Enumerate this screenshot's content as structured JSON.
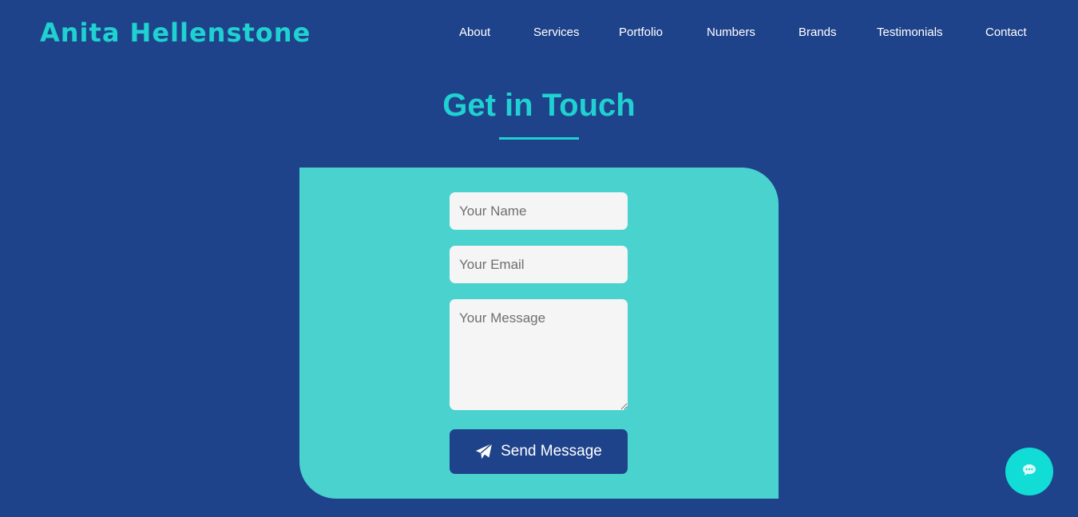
{
  "header": {
    "brand": "Anita Hellenstone",
    "nav": [
      {
        "label": "About"
      },
      {
        "label": "Services"
      },
      {
        "label": "Portfolio"
      },
      {
        "label": "Numbers"
      },
      {
        "label": "Brands"
      },
      {
        "label": "Testimonials"
      },
      {
        "label": "Contact"
      }
    ]
  },
  "contact": {
    "title": "Get in Touch",
    "form": {
      "name_placeholder": "Your Name",
      "email_placeholder": "Your Email",
      "message_placeholder": "Your Message",
      "submit_label": "Send Message",
      "submit_icon": "paper-plane-icon"
    }
  },
  "chat_widget": {
    "icon": "chat-bubble-icon"
  },
  "colors": {
    "background": "#1f438b",
    "accent": "#1fd1d0",
    "card": "#4ad2cf",
    "input_bg": "#f5f5f5",
    "button_bg": "#1f438b",
    "chat_button": "#12dcd6"
  }
}
